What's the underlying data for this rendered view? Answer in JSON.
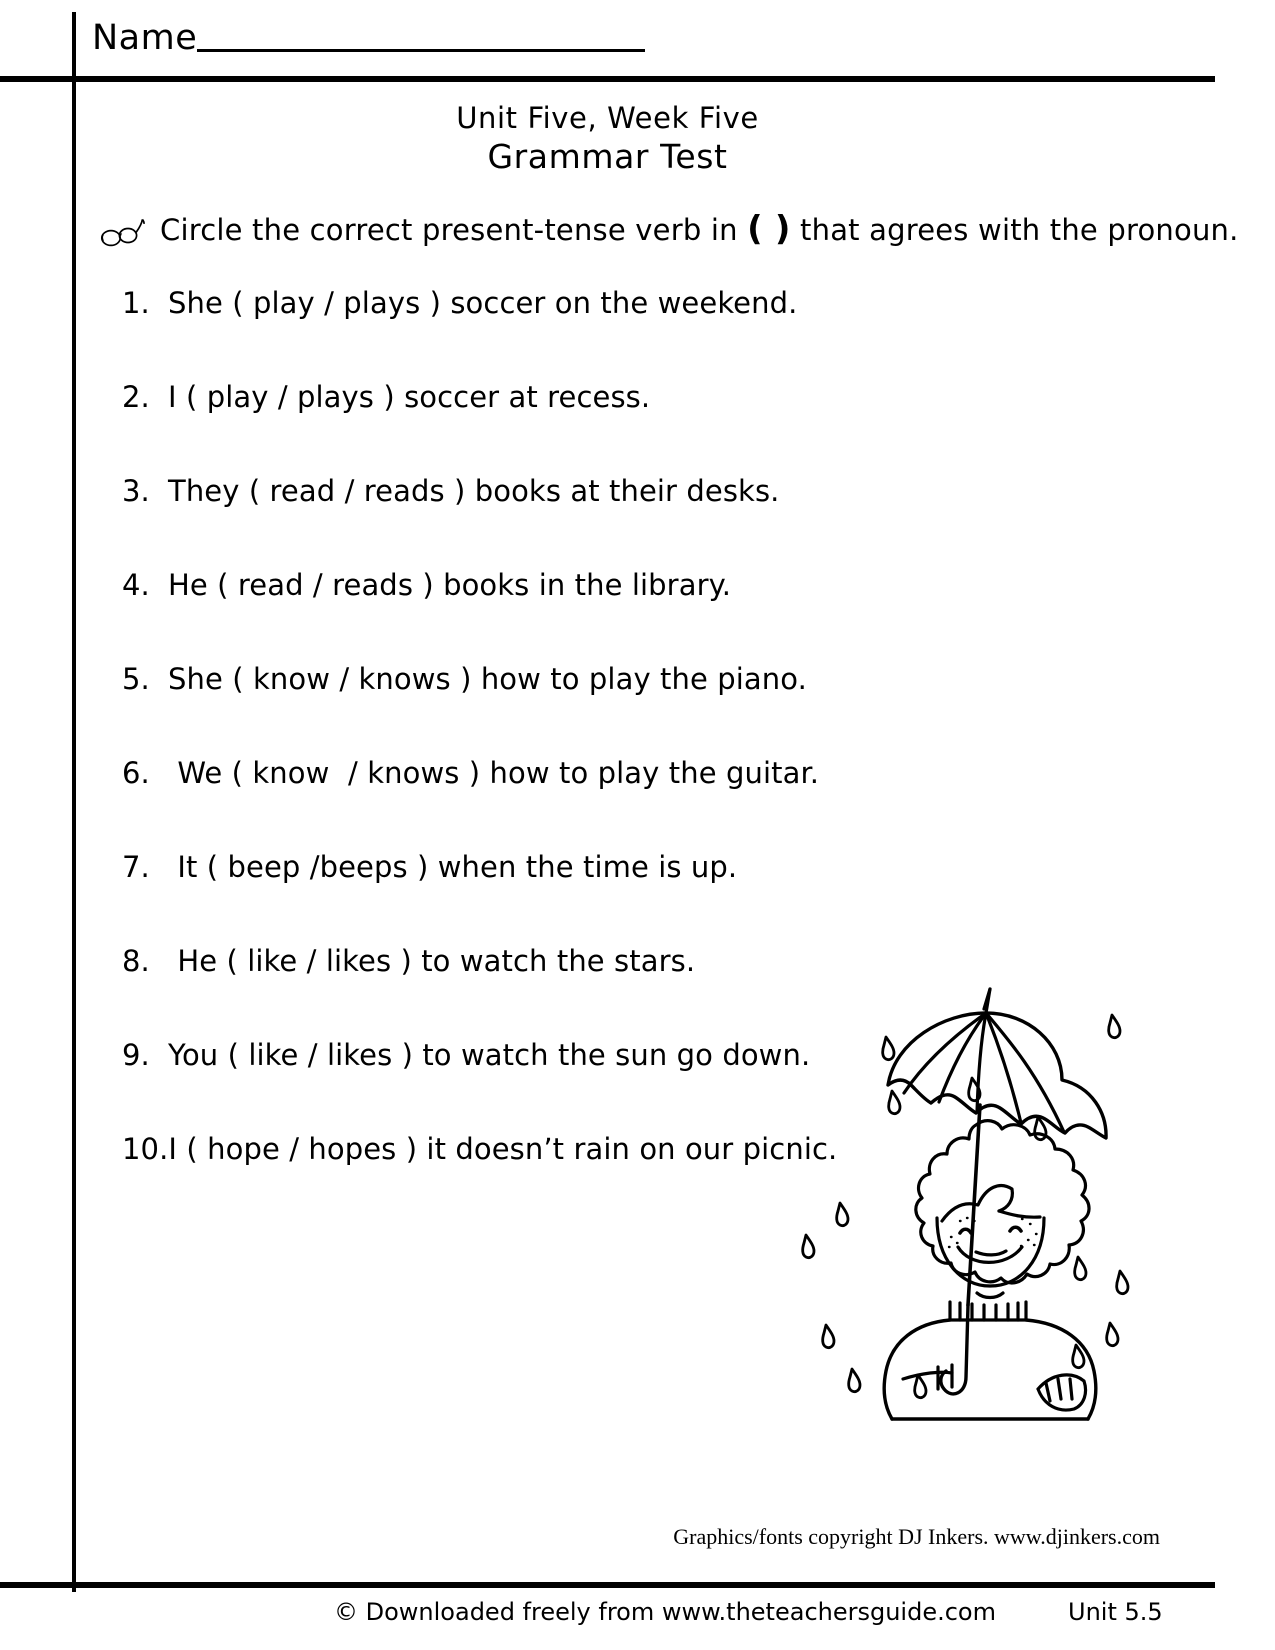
{
  "header": {
    "name_label": "Name",
    "title_line1": "Unit Five, Week Five",
    "title_line2": "Grammar Test"
  },
  "directions": {
    "icon": "eyeglasses-icon",
    "text_before_paren": "Circle the correct present-tense verb in ",
    "paren": "( )",
    "text_after_paren": " that agrees with the pronoun."
  },
  "questions": [
    {
      "number": "1.",
      "text": "She ( play / plays ) soccer on the weekend."
    },
    {
      "number": "2.",
      "text": "I ( play / plays ) soccer at recess."
    },
    {
      "number": "3.",
      "text": "They ( read / reads ) books at their desks."
    },
    {
      "number": "4.",
      "text": "He ( read / reads ) books in the library."
    },
    {
      "number": "5.",
      "text": "She ( know / knows ) how to play the piano."
    },
    {
      "number": "6.",
      "text": " We ( know  / knows ) how to play the guitar."
    },
    {
      "number": "7.",
      "text": " It ( beep /beeps ) when the time is up."
    },
    {
      "number": "8.",
      "text": " He ( like / likes ) to watch the stars."
    },
    {
      "number": "9.",
      "text": "You ( like / likes ) to watch the sun go down."
    },
    {
      "number": "10.",
      "text": "I ( hope / hopes ) it doesn’t rain on our picnic."
    }
  ],
  "illustration": {
    "name": "child-with-umbrella-in-rain-illustration"
  },
  "credits": {
    "djinkers": "Graphics/fonts copyright DJ Inkers. www.djinkers.com"
  },
  "footer": {
    "left": "© Downloaded freely from www.theteachersguide.com",
    "right": "Unit 5.5"
  },
  "colors": {
    "ink": "#000000",
    "paper": "#ffffff"
  }
}
